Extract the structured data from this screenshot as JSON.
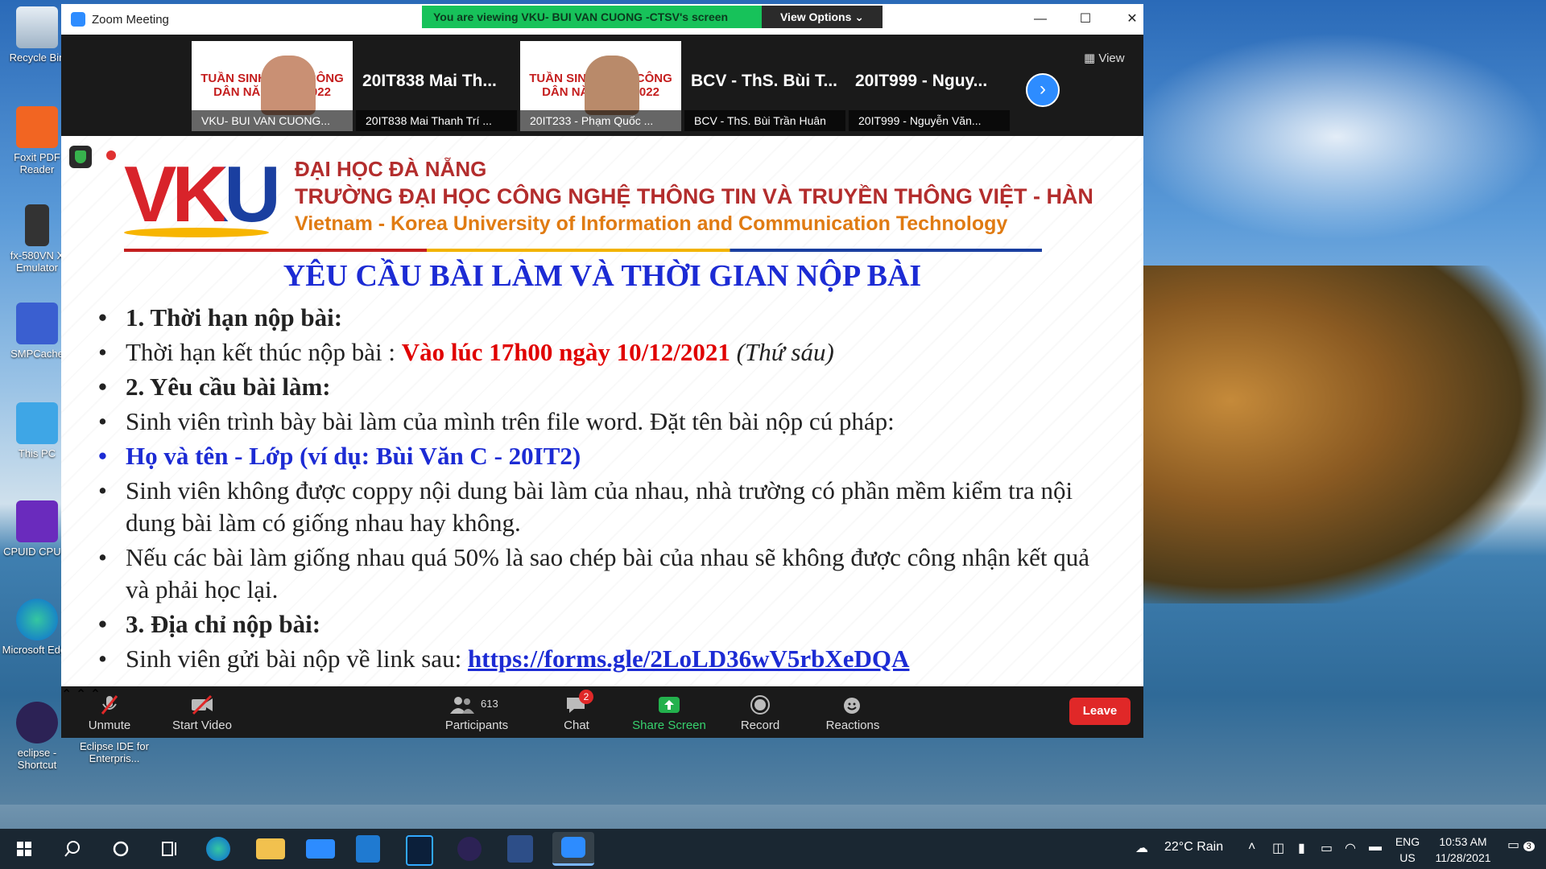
{
  "desktop": {
    "icons": [
      {
        "label": "Recycle Bin"
      },
      {
        "label": "Foxit PDF Reader"
      },
      {
        "label": "fx-580VN X Emulator"
      },
      {
        "label": "SMPCache"
      },
      {
        "label": "This PC"
      },
      {
        "label": "CPUID CPU-Z"
      },
      {
        "label": "Microsoft Edge"
      },
      {
        "label": "eclipse - Shortcut"
      },
      {
        "label": "Eclipse IDE for Enterpris..."
      }
    ]
  },
  "window": {
    "title": "Zoom Meeting",
    "banner": "You are viewing VKU- BUI VAN CUONG -CTSV's screen",
    "view_options": "View Options ⌄",
    "minimize": "—",
    "maximize": "☐",
    "close": "✕"
  },
  "participants_strip": {
    "view_label": "▦ View",
    "tiles": [
      {
        "name": "",
        "label": "VKU- BUI VAN CUONG...",
        "poster": "TUẦN SINH HOẠT CÔNG DÂN NĂM HỌC 2022"
      },
      {
        "name": "20IT838 Mai Th...",
        "label": "20IT838 Mai Thanh Trí ..."
      },
      {
        "name": "",
        "label": "20IT233 - Phạm Quốc ...",
        "poster": "TUẦN SINH HOẠT CÔNG DÂN NĂM HỌC 2022"
      },
      {
        "name": "BCV - ThS. Bùi T...",
        "label": "BCV - ThS. Bùi Trần Huân"
      },
      {
        "name": "20IT999 - Nguy...",
        "label": "20IT999 - Nguyễn Văn..."
      }
    ],
    "next": "›"
  },
  "slide": {
    "logo_text": "VKU",
    "uni_line1": "ĐẠI HỌC ĐÀ NẴNG",
    "uni_line2": "TRƯỜNG ĐẠI HỌC CÔNG NGHỆ THÔNG TIN VÀ TRUYỀN THÔNG VIỆT - HÀN",
    "uni_line3": "Vietnam - Korea University of Information and Communication Technology",
    "heading": "YÊU CẦU BÀI LÀM VÀ THỜI GIAN NỘP BÀI",
    "b1": "1. Thời hạn nộp bài:",
    "b2_prefix": "Thời hạn kết thúc nộp bài : ",
    "b2_deadline": "Vào lúc 17h00 ngày 10/12/2021",
    "b2_day": "(Thứ sáu)",
    "b3": "2. Yêu cầu bài làm:",
    "b4": "Sinh viên trình bày bài làm của mình trên file word. Đặt tên bài nộp cú pháp:",
    "b5": "Họ và tên - Lớp (ví dụ: Bùi Văn C - 20IT2)",
    "b6": "Sinh viên không được coppy nội dung bài làm của nhau, nhà trường có phần mềm kiểm tra nội dung bài làm có giống nhau hay không.",
    "b7": "Nếu các bài làm giống nhau quá 50% là sao chép bài của nhau sẽ không được công nhận kết quả và phải học lại.",
    "b8": "3. Địa chỉ nộp bài:",
    "b9_prefix": "Sinh viên gửi bài nộp về link sau: ",
    "b9_link": "https://forms.gle/2LoLD36wV5rbXeDQA"
  },
  "controls": {
    "unmute": "Unmute",
    "start_video": "Start Video",
    "participants": "Participants",
    "participants_count": "613",
    "chat": "Chat",
    "chat_badge": "2",
    "share_screen": "Share Screen",
    "record": "Record",
    "reactions": "Reactions",
    "leave": "Leave",
    "caret": "⌃"
  },
  "taskbar": {
    "weather": "22°C Rain",
    "lang_top": "ENG",
    "lang_bottom": "US",
    "time": "10:53 AM",
    "date": "11/28/2021",
    "notif_count": "3"
  },
  "colors": {
    "zoom_blue": "#2d8cff",
    "banner_green": "#17c25a",
    "leave_red": "#e02828",
    "slide_blue": "#1c2bd4",
    "slide_red": "#e00000"
  }
}
